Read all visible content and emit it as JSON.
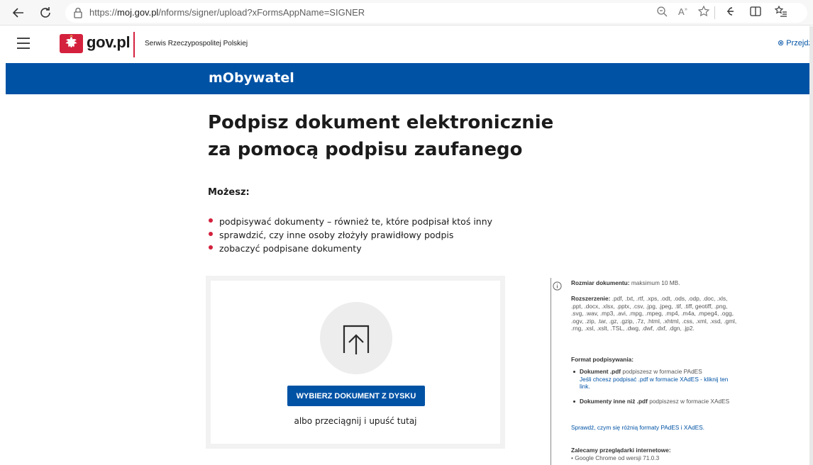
{
  "browser": {
    "url_prefix": "https://",
    "url_host": "moj.gov.pl",
    "url_path": "/nforms/signer/upload?xFormsAppName=SIGNER",
    "icons": [
      "back-icon",
      "reload-icon",
      "lock-icon",
      "zoom-icon",
      "read-aloud-icon",
      "favorite-icon",
      "extensions-icon",
      "split-screen-icon",
      "favorites-list-icon"
    ]
  },
  "header": {
    "logo_text": "gov.pl",
    "service_label": "Serwis Rzeczypospolitej Polskiej",
    "skip_link": "⊗ Przejdź"
  },
  "banner": {
    "title": "mObywatel"
  },
  "main": {
    "title_line1": "Podpisz dokument elektronicznie",
    "title_line2": "za pomocą podpisu zaufanego",
    "may_title": "Możesz:",
    "bullets": [
      "podpisywać dokumenty – również te, które podpisał ktoś inny",
      "sprawdzić, czy inne osoby złożyły prawidłowy podpis",
      "zobaczyć podpisane dokumenty"
    ]
  },
  "upload": {
    "button_label": "WYBIERZ DOKUMENT Z DYSKU",
    "drop_text": "albo przeciągnij i upuść tutaj"
  },
  "info": {
    "size_label": "Rozmiar dokumentu:",
    "size_value": "maksimum 10 MB.",
    "ext_label": "Rozszerzenie:",
    "ext_value": ".pdf, .txt, .rtf, .xps, .odt, .ods, .odp, .doc, .xls, .ppt, .docx, .xlsx, .pptx, .csv, .jpg, .jpeg, .tif, .tiff, geotiff, .png, .svg, .wav, .mp3, .avi, .mpg, .mpeg, .mp4, .m4a, .mpeg4, .ogg, .ogv, .zip, .tar, .gz, .gzip, .7z, .html, .xhtml, .css, .xml, .xsd, .gml, .rng, .xsl, .xslt, .TSL, .dwg, .dwf, .dxf, .dgn, .jp2.",
    "format_title": "Format podpisywania:",
    "format1_bold": "Dokument .pdf",
    "format1_text": "podpiszesz w formacie PAdES",
    "format1_link": "Jeśli chcesz podpisać .pdf w formacie XAdES - kliknij ten link.",
    "format2_bold": "Dokumenty inne niż .pdf",
    "format2_text": "podpiszesz w formacie XAdES",
    "compare_link": "Sprawdź, czym się różnią formaty PAdES i XAdES.",
    "browsers_title": "Zalecamy przeglądarki internetowe:",
    "browser1": "• Google Chrome od wersji 71.0.3"
  }
}
